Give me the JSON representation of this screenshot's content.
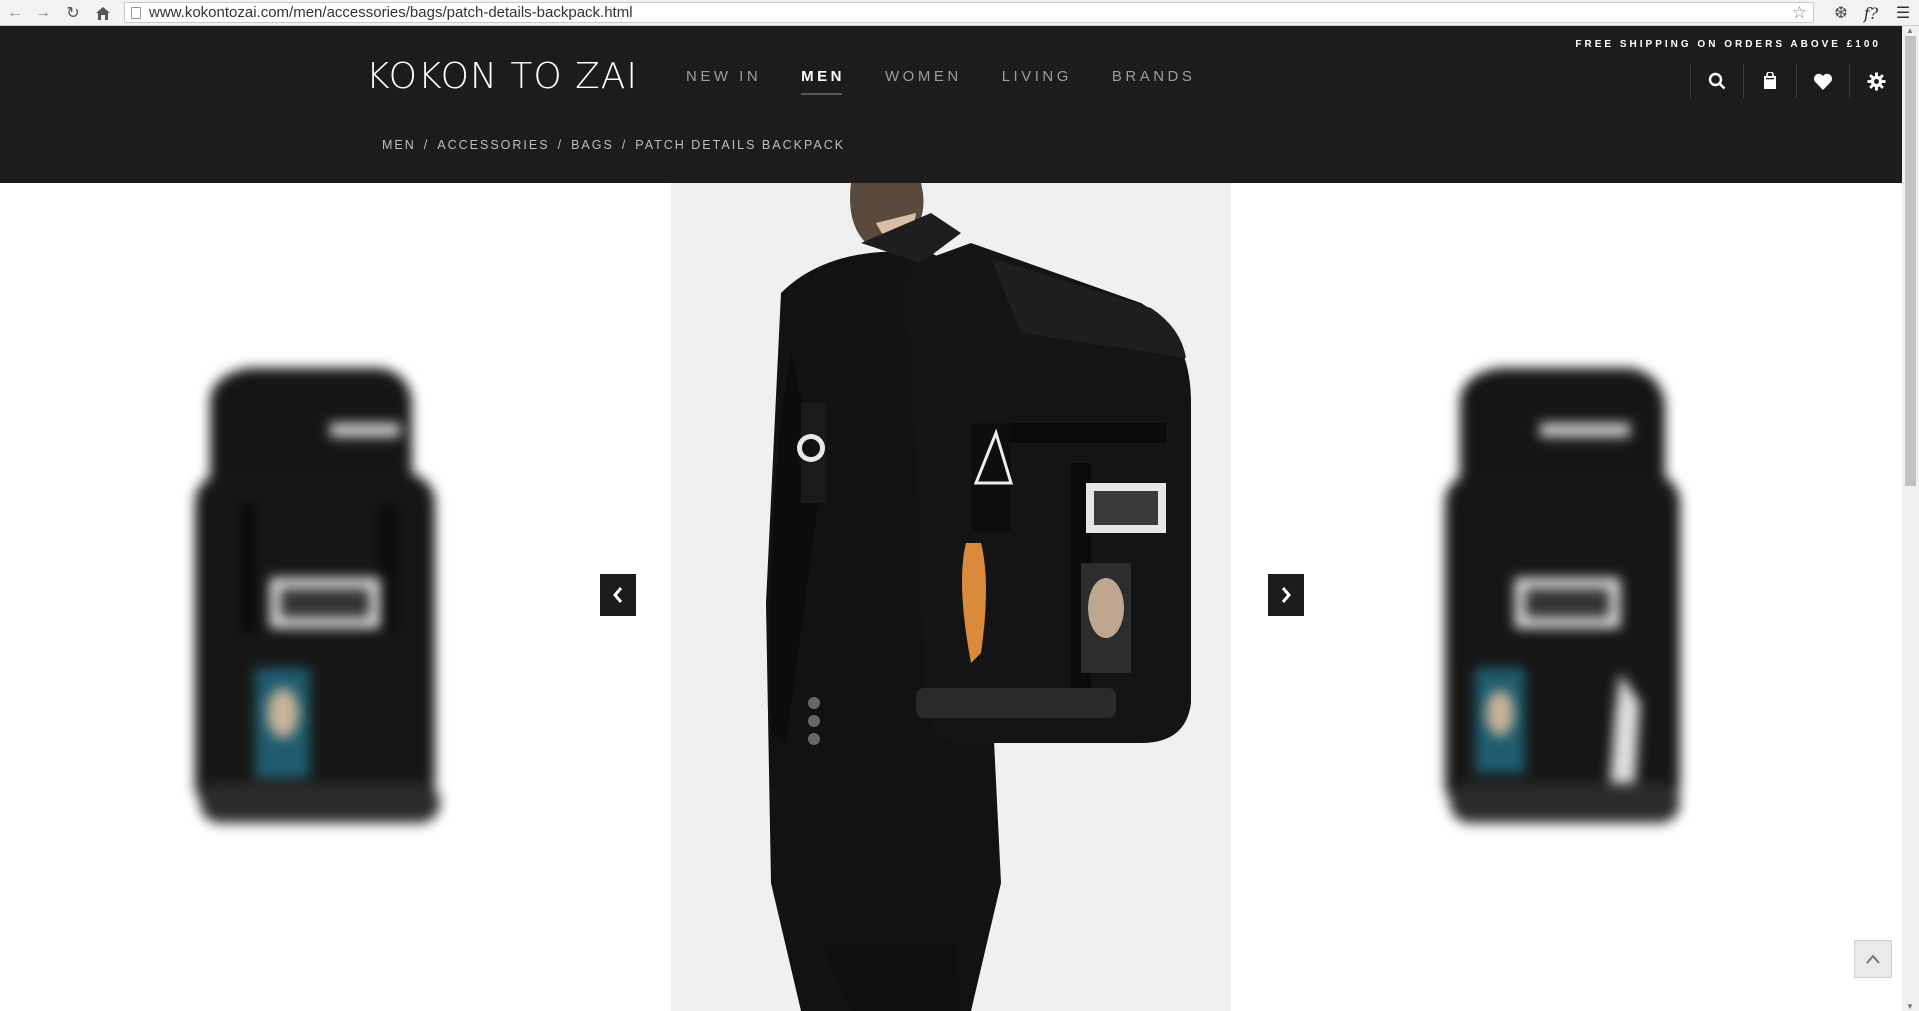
{
  "browser": {
    "url": "www.kokontozai.com/men/accessories/bags/patch-details-backpack.html"
  },
  "header": {
    "logo": "KOKON TO ZAI",
    "shipping_notice": "FREE SHIPPING ON ORDERS ABOVE £100",
    "nav": [
      {
        "label": "NEW IN"
      },
      {
        "label": "MEN"
      },
      {
        "label": "WOMEN"
      },
      {
        "label": "LIVING"
      },
      {
        "label": "BRANDS"
      }
    ],
    "active_nav": "MEN",
    "icons": [
      "search-icon",
      "shopping-bag-icon",
      "heart-icon",
      "gear-icon"
    ]
  },
  "breadcrumb": {
    "items": [
      "MEN",
      "ACCESSORIES",
      "BAGS",
      "PATCH DETAILS BACKPACK"
    ],
    "separator": "/"
  },
  "carousel": {
    "slides": [
      "backpack-front",
      "model-wearing-backpack",
      "backpack-side"
    ],
    "active_slide": 2,
    "prev_icon": "chevron-left-icon",
    "next_icon": "chevron-right-icon"
  },
  "colors": {
    "header_bg": "#1c1c1c",
    "nav_inactive": "#9c9c9c",
    "nav_active": "#ffffff"
  }
}
